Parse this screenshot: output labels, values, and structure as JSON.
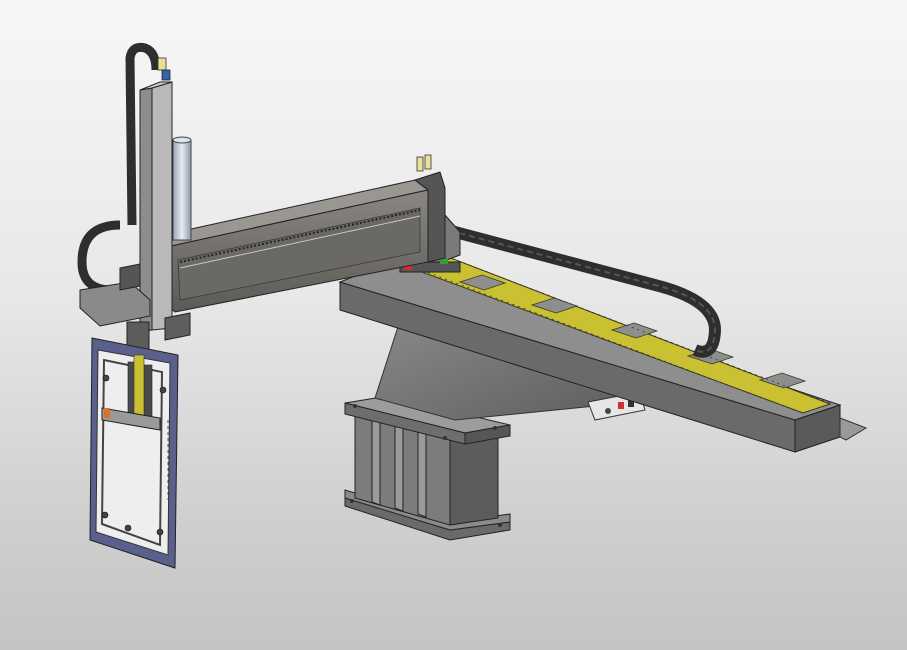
{
  "view": {
    "subject": "gantry robot",
    "background": [
      "#f7f7f7",
      "#c4c4c4"
    ]
  },
  "colors": {
    "beam": "#6e6b66",
    "beam_dark": "#4a4845",
    "cable_chain": "#3a3a3a",
    "rail_strip": "#c9c032",
    "base_metal": "#7a7a7a",
    "frame_blue": "#5a5f8c",
    "accent_red": "#d23030",
    "accent_green": "#3a9a3a"
  }
}
